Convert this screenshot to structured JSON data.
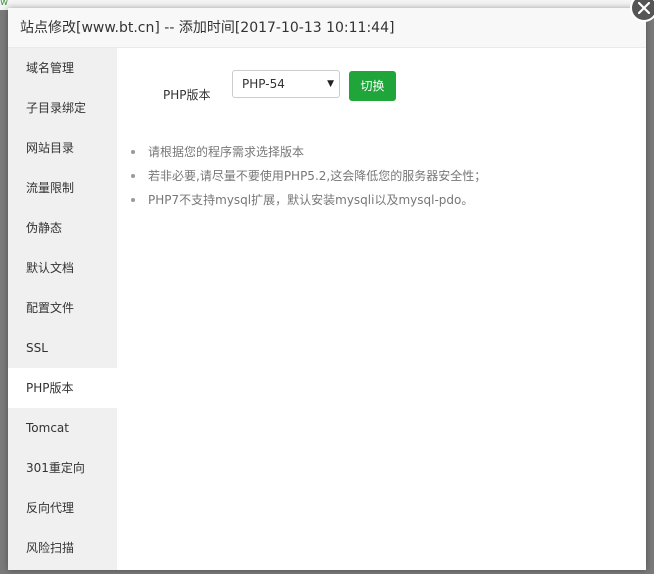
{
  "background": {
    "partial_text": "w"
  },
  "dialog": {
    "title": "站点修改[www.bt.cn] -- 添加时间[2017-10-13 10:11:44]",
    "close_icon": "close-icon"
  },
  "sidebar": {
    "active_index": 8,
    "items": [
      {
        "label": "域名管理"
      },
      {
        "label": "子目录绑定"
      },
      {
        "label": "网站目录"
      },
      {
        "label": "流量限制"
      },
      {
        "label": "伪静态"
      },
      {
        "label": "默认文档"
      },
      {
        "label": "配置文件"
      },
      {
        "label": "SSL"
      },
      {
        "label": "PHP版本"
      },
      {
        "label": "Tomcat"
      },
      {
        "label": "301重定向"
      },
      {
        "label": "反向代理"
      },
      {
        "label": "风险扫描"
      }
    ]
  },
  "php_version": {
    "label": "PHP版本",
    "select_value": "PHP-54",
    "select_arrow": "▼",
    "switch_button": "切换"
  },
  "tips": [
    "请根据您的程序需求选择版本",
    "若非必要,请尽量不要使用PHP5.2,这会降低您的服务器安全性；",
    "PHP7不支持mysql扩展，默认安装mysqli以及mysql-pdo。"
  ],
  "colors": {
    "accent_green": "#20a53a",
    "sidebar_bg": "#f0f0f0",
    "overlay": "#7a7a7a"
  }
}
